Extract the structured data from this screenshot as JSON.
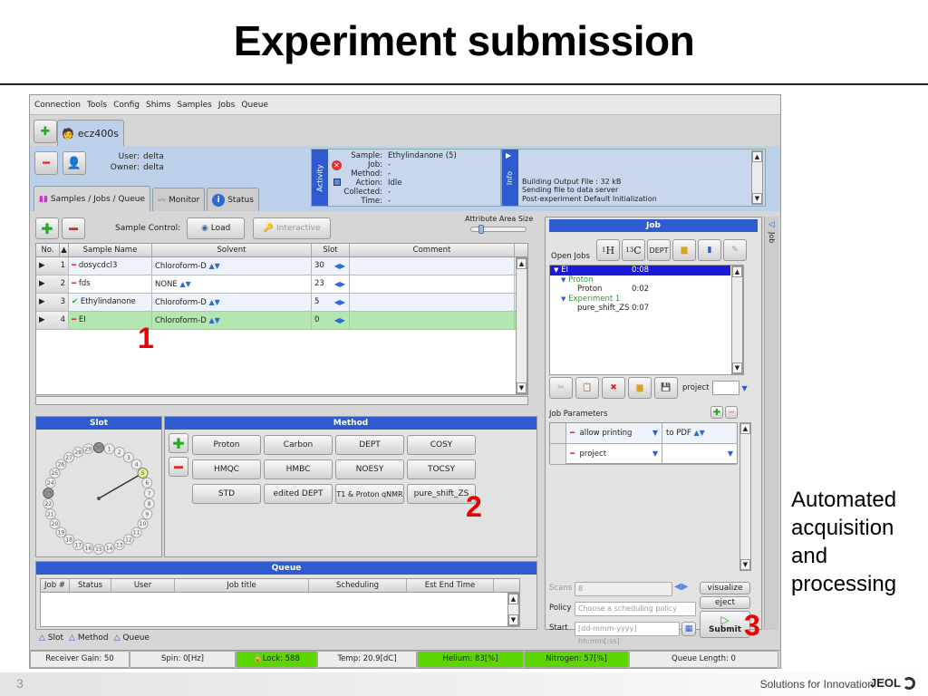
{
  "slide": {
    "title": "Experiment submission",
    "side_text": "Automated\nacquisition\nand\nprocessing",
    "page_number": "3",
    "tagline": "Solutions for Innovation",
    "logo": "JEOL"
  },
  "app": {
    "menu": [
      "Connection",
      "Tools",
      "Config",
      "Shims",
      "Samples",
      "Jobs",
      "Queue"
    ],
    "instrument_tab": "ecz400s",
    "user_label": "User:",
    "user": "delta",
    "owner_label": "Owner:",
    "owner": "delta",
    "activity": {
      "strip_label": "Activity",
      "rows": [
        {
          "k": "Sample:",
          "v": "Ethylindanone  (5)"
        },
        {
          "k": "Job:",
          "v": "-"
        },
        {
          "k": "Method:",
          "v": "-"
        },
        {
          "k": "Action:",
          "v": "Idle"
        },
        {
          "k": "Collected:",
          "v": "-"
        },
        {
          "k": "Time:",
          "v": "-"
        }
      ]
    },
    "info": {
      "strip_label": "Info",
      "lines": [
        "Building Output File : 32 kB",
        "Sending file to data server",
        "Post-experiment Default Initialization"
      ]
    },
    "subtabs": [
      "Samples / Jobs / Queue",
      "Monitor",
      "Status"
    ],
    "sample_control_label": "Sample Control:",
    "load_label": "Load",
    "interactive_label": "Interactive",
    "attribute_area_label": "Attribute Area Size",
    "attribute_area_value": 0.15,
    "sample_table": {
      "headers": [
        "No.",
        "Sample Name",
        "Solvent",
        "Slot",
        "Comment"
      ],
      "rows": [
        {
          "no": "1",
          "status": "minus",
          "name": "dosycdcl3",
          "solvent": "Chloroform-D",
          "slot": "30",
          "comment": ""
        },
        {
          "no": "2",
          "status": "minus",
          "name": "fds",
          "solvent": "NONE",
          "slot": "23",
          "comment": ""
        },
        {
          "no": "3",
          "status": "check",
          "name": "Ethylindanone",
          "solvent": "Chloroform-D",
          "slot": "5",
          "comment": ""
        },
        {
          "no": "4",
          "status": "minus",
          "name": "EI",
          "solvent": "Chloroform-D",
          "slot": "0",
          "comment": ""
        }
      ]
    },
    "slot_panel": {
      "title": "Slot",
      "slots": 30,
      "selected_slot": 5,
      "occupied_slots": [
        30,
        23
      ]
    },
    "method_panel": {
      "title": "Method",
      "buttons": [
        "Proton",
        "Carbon",
        "DEPT",
        "COSY",
        "HMQC",
        "HMBC",
        "NOESY",
        "TOCSY",
        "STD",
        "edited DEPT",
        "T1 & Proton qNMR",
        "pure_shift_ZS"
      ]
    },
    "queue_panel": {
      "title": "Queue",
      "headers": [
        "Job #",
        "Status",
        "User",
        "Job title",
        "Scheduling",
        "Est End Time"
      ]
    },
    "bottom_links": [
      "Slot",
      "Method",
      "Queue"
    ],
    "job_panel": {
      "title": "Job",
      "open_jobs_label": "Open Jobs",
      "tool_buttons": [
        "1H",
        "13C",
        "DEPT"
      ],
      "tree": [
        {
          "label": "EI",
          "time": "0:08",
          "level": 0,
          "selected": true,
          "expanded": true
        },
        {
          "label": "Proton",
          "time": "",
          "level": 1,
          "group": true,
          "expanded": true
        },
        {
          "label": "Proton",
          "time": "0:02",
          "level": 2
        },
        {
          "label": "Experiment 1",
          "time": "",
          "level": 1,
          "group": true,
          "expanded": true
        },
        {
          "label": "pure_shift_ZS",
          "time": "0:07",
          "level": 2
        }
      ],
      "project_label": "project",
      "job_params_label": "Job Parameters",
      "params": [
        {
          "name": "allow printing",
          "value": "to PDF"
        },
        {
          "name": "project",
          "value": ""
        }
      ],
      "scans_label": "Scans",
      "scans_value": "8",
      "policy_label": "Policy",
      "policy_placeholder": "Choose a scheduling policy",
      "start_label": "Start",
      "start_placeholder": "[dd-mmm-yyyy] hh:mm[:ss]",
      "visualize_label": "visualize",
      "eject_label": "eject",
      "submit_label": "Submit",
      "side_tab": "Job"
    },
    "statusbar": [
      {
        "label": "Receiver Gain: 50",
        "ok": false
      },
      {
        "label": "Spin: 0[Hz]",
        "ok": false
      },
      {
        "label": "Lock: 588",
        "ok": true
      },
      {
        "label": "Temp: 20.9[dC]",
        "ok": false
      },
      {
        "label": "Helium: 83[%]",
        "ok": true
      },
      {
        "label": "Nitrogen: 57[%]",
        "ok": true
      },
      {
        "label": "Queue Length: 0",
        "ok": false
      }
    ]
  },
  "annotations": [
    "1",
    "2",
    "3"
  ]
}
